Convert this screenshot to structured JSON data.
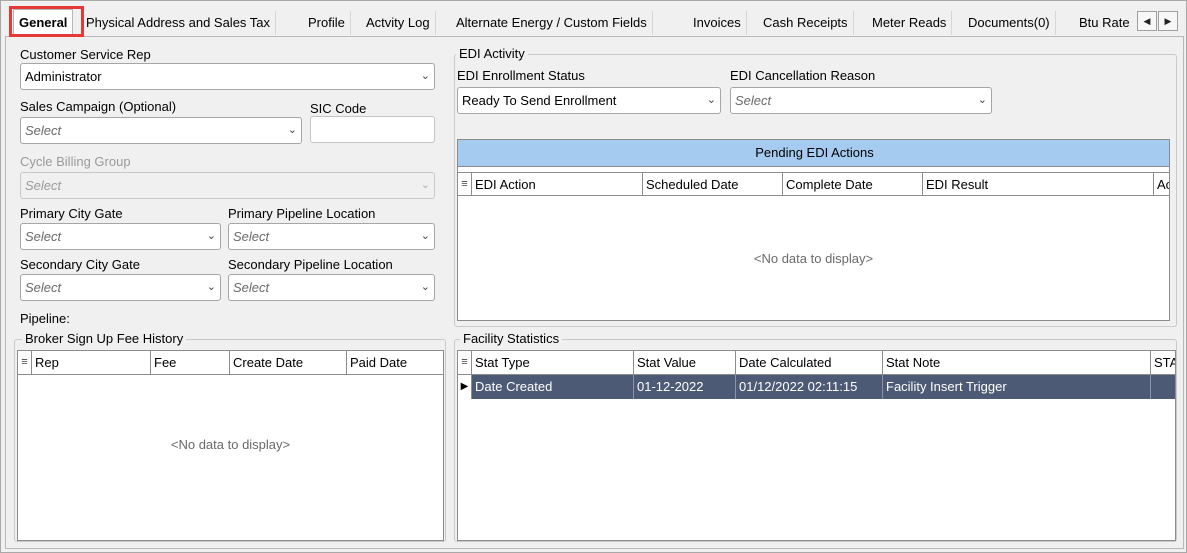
{
  "tabs": [
    {
      "label": "General",
      "active": true
    },
    {
      "label": "Physical Address and Sales Tax"
    },
    {
      "label": "Profile"
    },
    {
      "label": "Actvity Log"
    },
    {
      "label": "Alternate Energy / Custom Fields"
    },
    {
      "label": "Invoices"
    },
    {
      "label": "Cash Receipts"
    },
    {
      "label": "Meter Reads"
    },
    {
      "label": "Documents(0)"
    },
    {
      "label": "Btu Rate"
    }
  ],
  "tab_scroll": {
    "left": "◀",
    "right": "▶"
  },
  "form": {
    "csr": {
      "label": "Customer Service Rep",
      "value": "Administrator"
    },
    "sales_campaign": {
      "label": "Sales Campaign (Optional)",
      "placeholder": "Select"
    },
    "sic_code": {
      "label": "SIC Code",
      "value": ""
    },
    "cycle_billing_group": {
      "label": "Cycle Billing Group",
      "placeholder": "Select"
    },
    "primary_city_gate": {
      "label": "Primary City Gate",
      "placeholder": "Select"
    },
    "primary_pipeline_location": {
      "label": "Primary Pipeline Location",
      "placeholder": "Select"
    },
    "secondary_city_gate": {
      "label": "Secondary City Gate",
      "placeholder": "Select"
    },
    "secondary_pipeline_location": {
      "label": "Secondary Pipeline Location",
      "placeholder": "Select"
    },
    "pipeline": {
      "label": "Pipeline:"
    }
  },
  "edi": {
    "title": "EDI Activity",
    "enrollment_status": {
      "label": "EDI Enrollment Status",
      "value": "Ready To Send Enrollment"
    },
    "cancellation_reason": {
      "label": "EDI Cancellation Reason",
      "placeholder": "Select"
    },
    "pending": {
      "caption": "Pending EDI Actions",
      "columns": [
        "EDI Action",
        "Scheduled Date",
        "Complete Date",
        "EDI Result",
        "Ac"
      ],
      "empty": "<No data to display>"
    }
  },
  "broker": {
    "title": "Broker Sign Up Fee History",
    "columns": [
      "Rep",
      "Fee",
      "Create Date",
      "Paid Date"
    ],
    "empty": "<No data to display>"
  },
  "facility": {
    "title": "Facility Statistics",
    "columns": [
      "Stat Type",
      "Stat Value",
      "Date Calculated",
      "Stat Note",
      "STA"
    ],
    "rows": [
      [
        "Date Created",
        "01-12-2022",
        "01/12/2022 02:11:15",
        "Facility Insert Trigger",
        ""
      ]
    ]
  },
  "icons": {
    "dropdown": "chevron-down-icon",
    "column-chooser": "column-chooser-icon",
    "row-indicator": "row-indicator-icon"
  }
}
